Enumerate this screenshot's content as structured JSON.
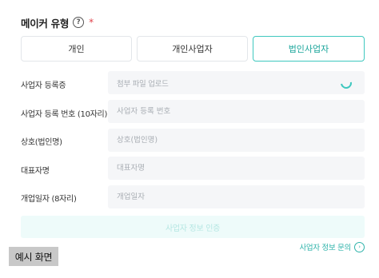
{
  "form": {
    "title": "메이커 유형",
    "required_mark": "*",
    "maker_types": [
      "개인",
      "개인사업자",
      "법인사업자"
    ],
    "selected_type": "법인사업자",
    "fields": [
      {
        "label": "사업자 등록증",
        "placeholder": "첨부 파일 업로드",
        "loading": true
      },
      {
        "label": "사업자 등록 번호 (10자리)",
        "placeholder": "사업자 등록 번호"
      },
      {
        "label": "상호(법인명)",
        "placeholder": "상호(법인명)"
      },
      {
        "label": "대표자명",
        "placeholder": "대표자명"
      },
      {
        "label": "개업일자 (8자리)",
        "placeholder": "개업일자"
      }
    ],
    "verify_button": "사업자 정보 인증",
    "inquiry_link": "사업자 정보 문의"
  },
  "example_badge": "예시 화면",
  "colors": {
    "accent": "#3fc8bf",
    "required": "#e0434b",
    "field_bg": "#f5f6f8"
  },
  "icons": {
    "help": "question-circle",
    "inquiry": "arrow-right-circle",
    "upload_status": "loading-spinner"
  }
}
